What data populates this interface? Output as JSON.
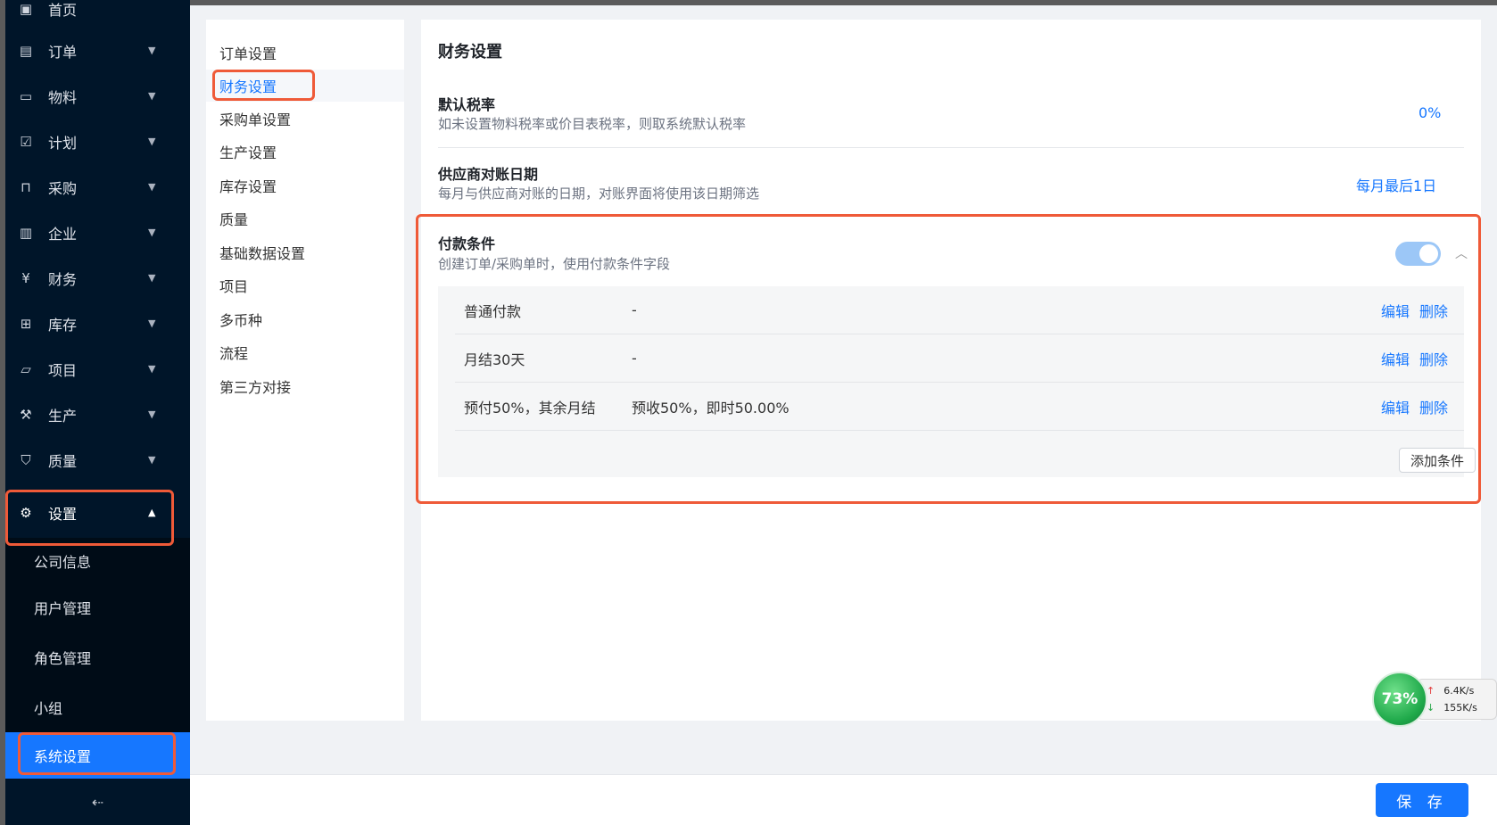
{
  "sidebar": {
    "items": [
      {
        "label": "首页",
        "icon": "home-icon"
      },
      {
        "label": "订单",
        "icon": "order-icon"
      },
      {
        "label": "物料",
        "icon": "material-icon"
      },
      {
        "label": "计划",
        "icon": "calendar-check-icon"
      },
      {
        "label": "采购",
        "icon": "bag-icon"
      },
      {
        "label": "企业",
        "icon": "building-icon"
      },
      {
        "label": "财务",
        "icon": "yen-icon"
      },
      {
        "label": "库存",
        "icon": "inventory-icon"
      },
      {
        "label": "项目",
        "icon": "folder-icon"
      },
      {
        "label": "生产",
        "icon": "wrench-icon"
      },
      {
        "label": "质量",
        "icon": "shield-check-icon"
      },
      {
        "label": "设置",
        "icon": "gear-icon"
      }
    ],
    "submenu": [
      "公司信息",
      "用户管理",
      "角色管理",
      "小组",
      "系统设置"
    ],
    "collapse_label": "⇠"
  },
  "settings_menu": [
    "订单设置",
    "财务设置",
    "采购单设置",
    "生产设置",
    "库存设置",
    "质量",
    "基础数据设置",
    "项目",
    "多币种",
    "流程",
    "第三方对接"
  ],
  "content": {
    "title": "财务设置",
    "default_tax": {
      "title": "默认税率",
      "desc": "如未设置物料税率或价目表税率，则取系统默认税率",
      "value": "0%"
    },
    "supplier_date": {
      "title": "供应商对账日期",
      "desc": "每月与供应商对账的日期，对账界面将使用该日期筛选",
      "value": "每月最后1日"
    },
    "payment": {
      "title": "付款条件",
      "desc": "创建订单/采购单时，使用付款条件字段",
      "enabled": true,
      "rows": [
        {
          "name": "普通付款",
          "rule": "-",
          "edit": "编辑",
          "delete": "删除"
        },
        {
          "name": "月结30天",
          "rule": "-",
          "edit": "编辑",
          "delete": "删除"
        },
        {
          "name": "预付50%，其余月结",
          "rule": "预收50%，即时50.00%",
          "edit": "编辑",
          "delete": "删除"
        }
      ],
      "add_label": "添加条件"
    }
  },
  "footer": {
    "save_label": "保 存"
  },
  "network": {
    "percent": "73%",
    "up": "6.4K/s",
    "down": "155K/s"
  },
  "colors": {
    "accent": "#1677ff",
    "sidebar": "#001529",
    "highlight": "#ef5a38"
  }
}
